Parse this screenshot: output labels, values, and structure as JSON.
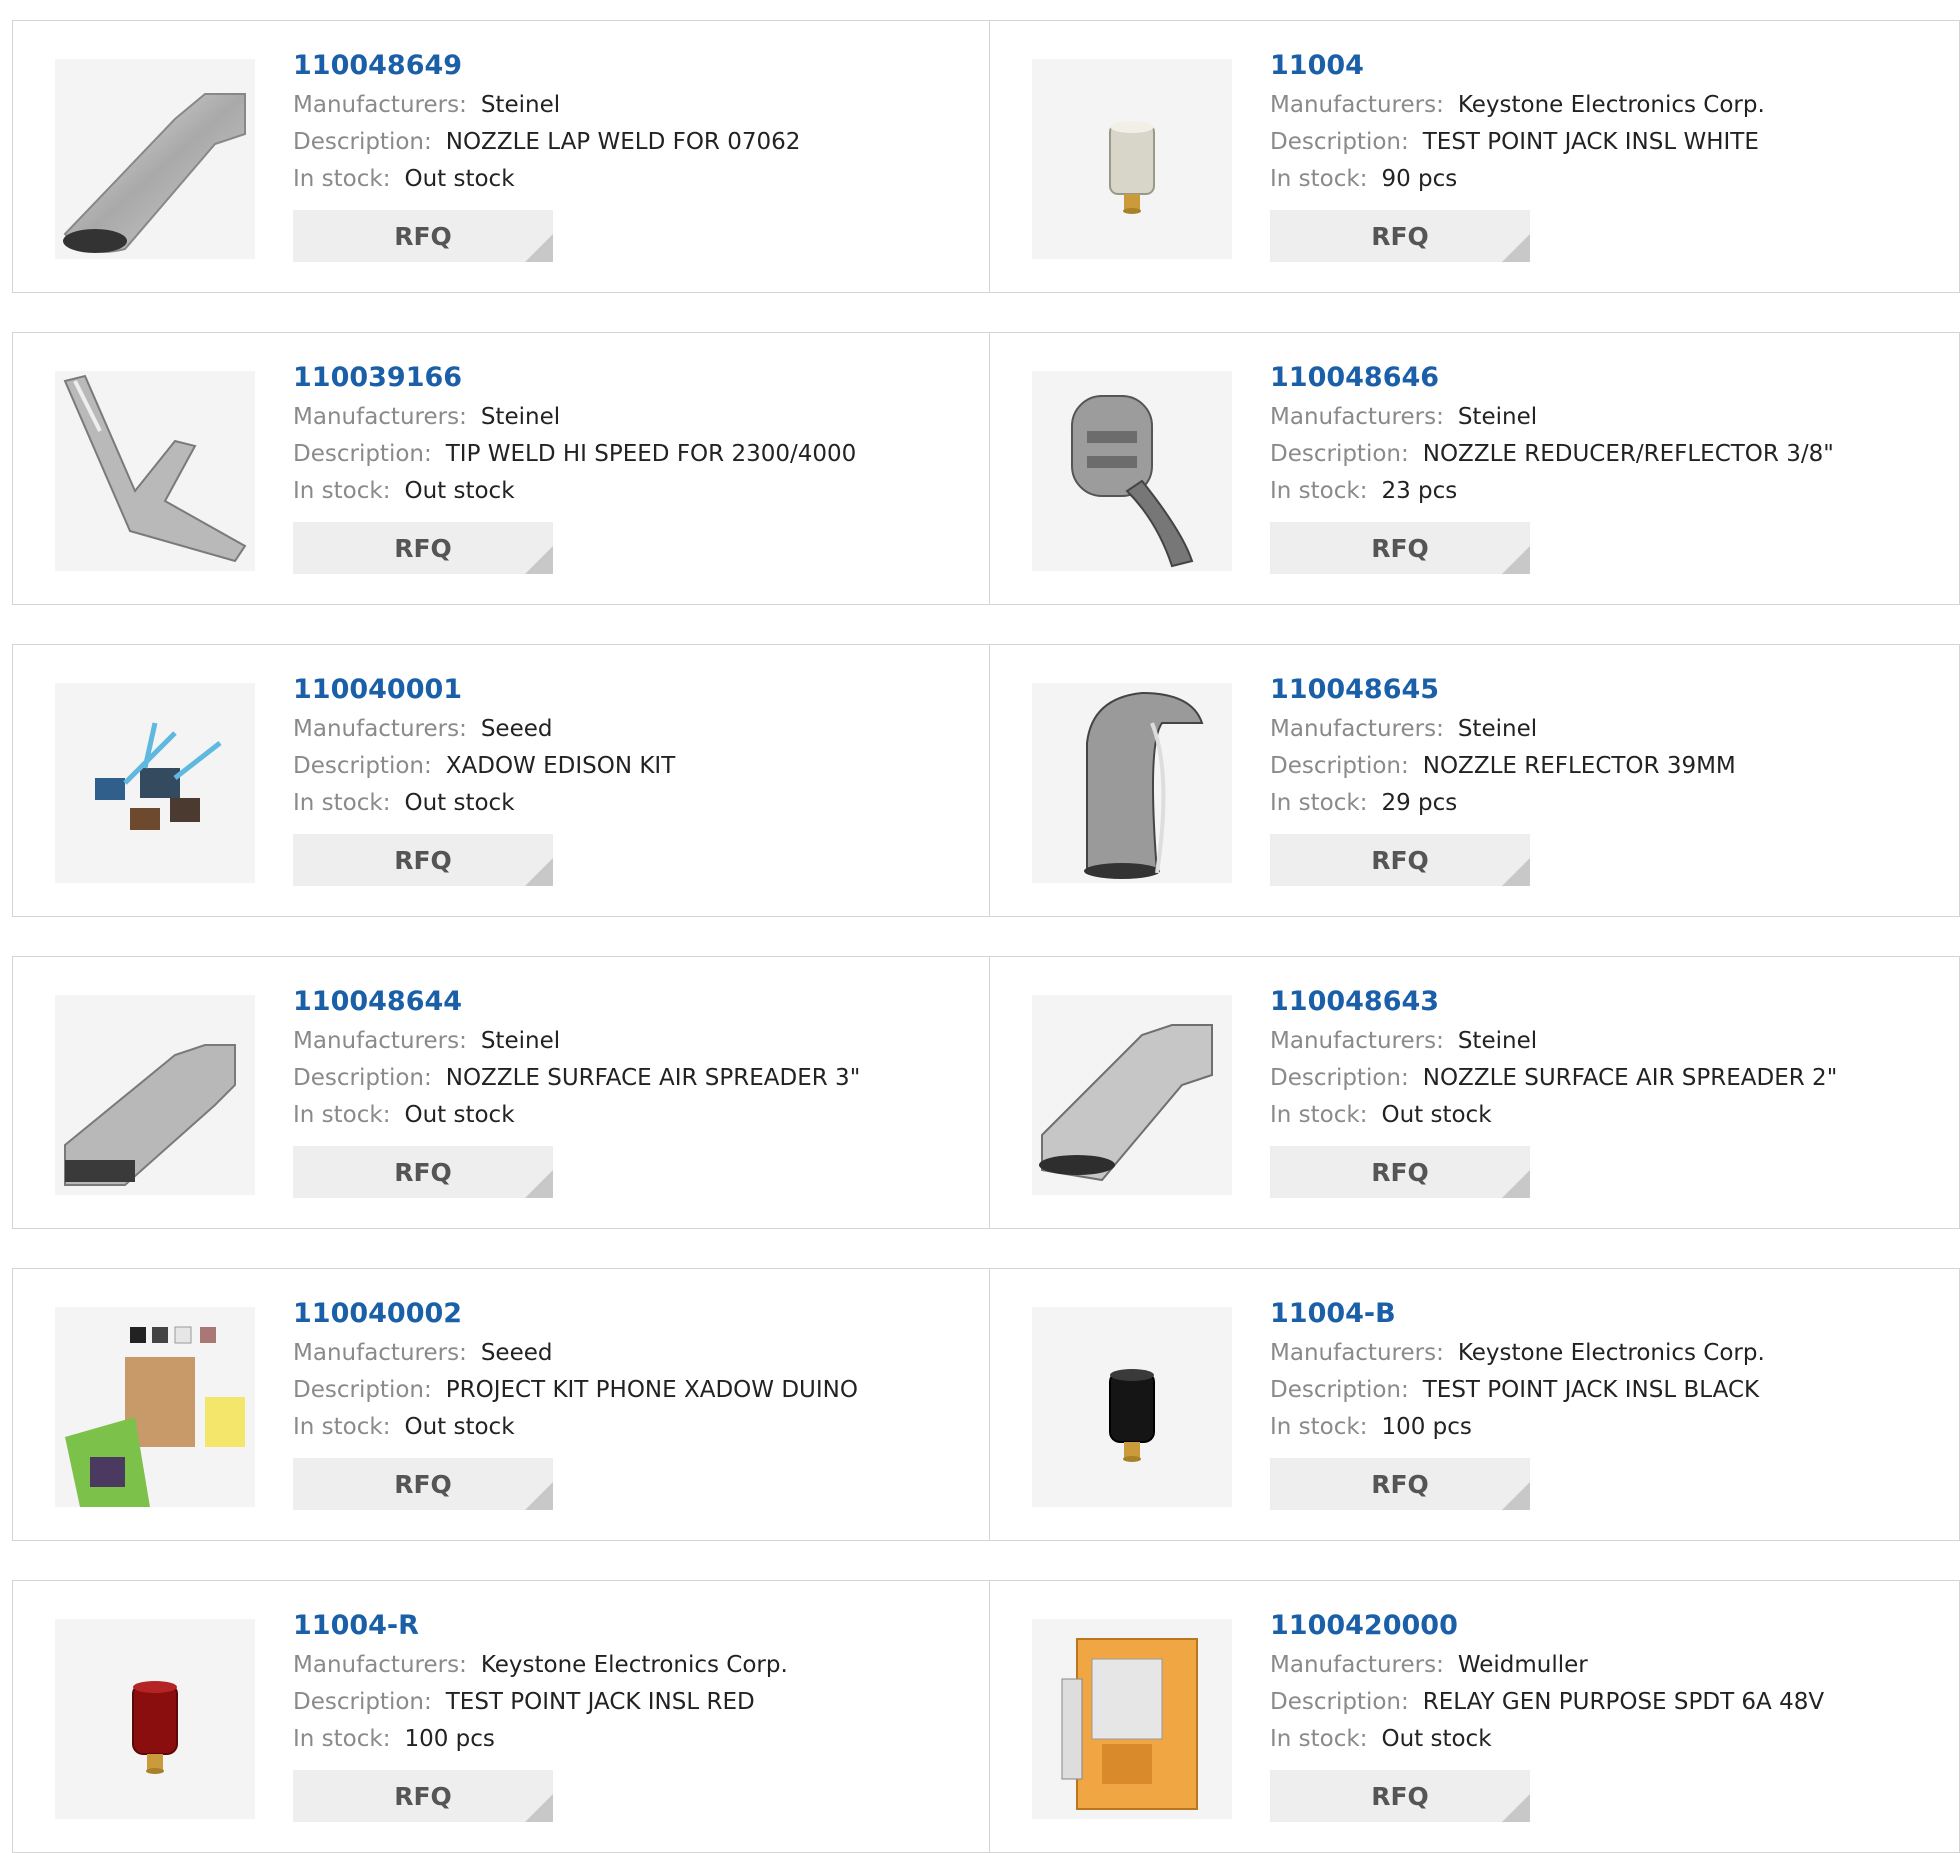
{
  "labels": {
    "manufacturers": "Manufacturers:",
    "description": "Description:",
    "in_stock": "In stock:",
    "rfq": "RFQ"
  },
  "products": [
    {
      "part": "110048649",
      "manufacturer": "Steinel",
      "description": "NOZZLE LAP WELD FOR 07062",
      "stock": "Out stock",
      "icon": "lap-weld-nozzle-icon"
    },
    {
      "part": "11004",
      "manufacturer": "Keystone Electronics Corp.",
      "description": "TEST POINT JACK INSL WHITE",
      "stock": "90 pcs",
      "icon": "test-point-jack-white-icon"
    },
    {
      "part": "110039166",
      "manufacturer": "Steinel",
      "description": "TIP WELD HI SPEED FOR 2300/4000",
      "stock": "Out stock",
      "icon": "speed-weld-tip-icon"
    },
    {
      "part": "110048646",
      "manufacturer": "Steinel",
      "description": "NOZZLE REDUCER/REFLECTOR 3/8\"",
      "stock": "23 pcs",
      "icon": "reducer-nozzle-icon"
    },
    {
      "part": "110040001",
      "manufacturer": "Seeed",
      "description": "XADOW EDISON KIT",
      "stock": "Out stock",
      "icon": "edison-kit-icon"
    },
    {
      "part": "110048645",
      "manufacturer": "Steinel",
      "description": "NOZZLE REFLECTOR 39MM",
      "stock": "29 pcs",
      "icon": "reflector-nozzle-icon"
    },
    {
      "part": "110048644",
      "manufacturer": "Steinel",
      "description": "NOZZLE SURFACE AIR SPREADER 3\"",
      "stock": "Out stock",
      "icon": "air-spreader-nozzle-icon"
    },
    {
      "part": "110048643",
      "manufacturer": "Steinel",
      "description": "NOZZLE SURFACE AIR SPREADER 2\"",
      "stock": "Out stock",
      "icon": "air-spreader-nozzle-icon"
    },
    {
      "part": "110040002",
      "manufacturer": "Seeed",
      "description": "PROJECT KIT PHONE XADOW DUINO",
      "stock": "Out stock",
      "icon": "phone-project-kit-icon"
    },
    {
      "part": "11004-B",
      "manufacturer": "Keystone Electronics Corp.",
      "description": "TEST POINT JACK INSL BLACK",
      "stock": "100 pcs",
      "icon": "test-point-jack-black-icon"
    },
    {
      "part": "11004-R",
      "manufacturer": "Keystone Electronics Corp.",
      "description": "TEST POINT JACK INSL RED",
      "stock": "100 pcs",
      "icon": "test-point-jack-red-icon"
    },
    {
      "part": "1100420000",
      "manufacturer": "Weidmuller",
      "description": "RELAY GEN PURPOSE SPDT 6A 48V",
      "stock": "Out stock",
      "icon": "relay-module-icon"
    }
  ],
  "colors": {
    "part_link": "#1a5fa8",
    "label": "#8a8a8a",
    "rfq_background": "#eeeeee"
  }
}
